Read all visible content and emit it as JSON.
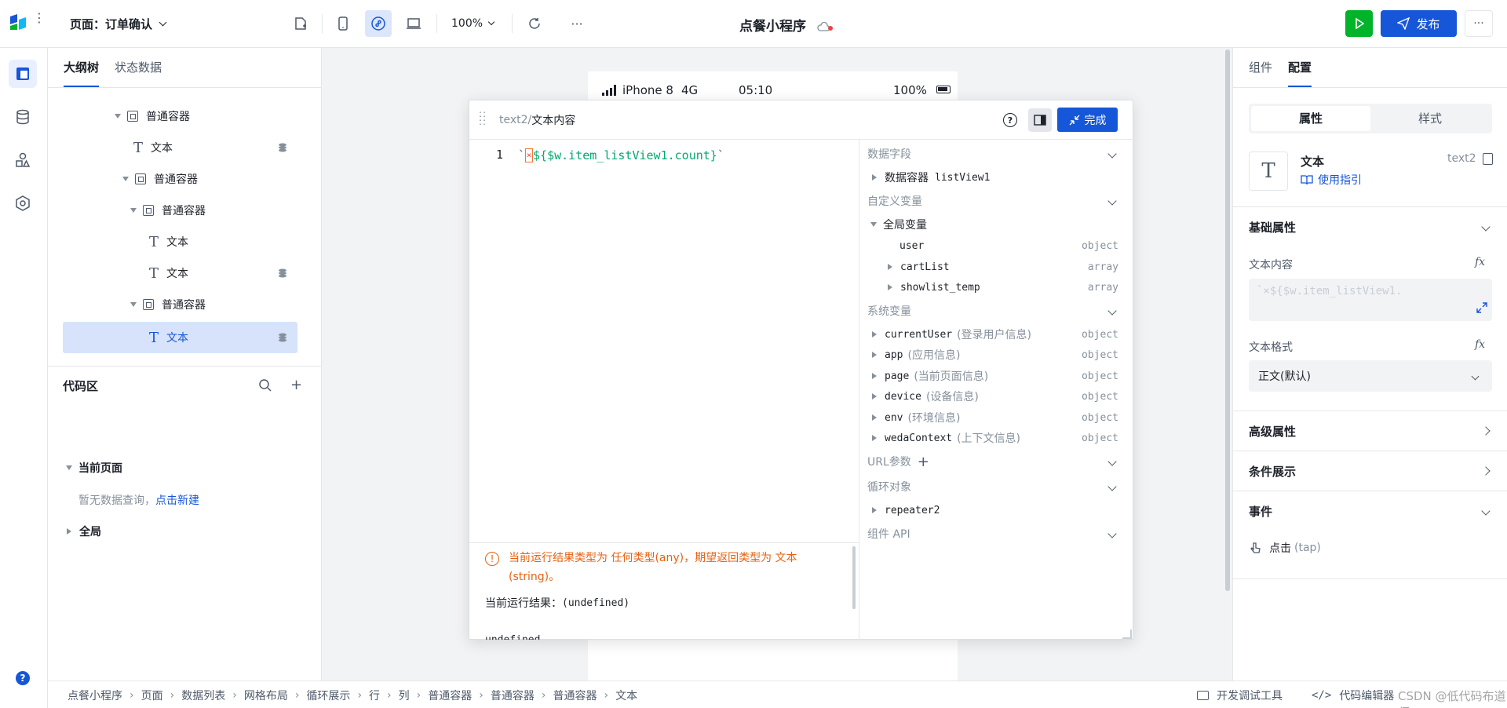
{
  "topbar": {
    "page_label": "页面：订单确认",
    "zoom": "100%",
    "app_title": "点餐小程序",
    "publish_label": "发布"
  },
  "outline": {
    "tabs": [
      "大纲树",
      "状态数据"
    ],
    "nodes": [
      "普通容器",
      "文本",
      "普通容器",
      "普通容器",
      "文本",
      "文本",
      "普通容器",
      "文本"
    ],
    "code_title": "代码区",
    "current_page": "当前页面",
    "empty_text": "暂无数据查询，",
    "create_link": "点击新建",
    "global": "全局"
  },
  "phone": {
    "carrier": "iPhone 8",
    "network": "4G",
    "time": "05:10",
    "battery": "100%"
  },
  "editor": {
    "crumb_prefix": "text2/",
    "crumb_title": "文本内容",
    "done_label": "完成",
    "line_no": "1",
    "code_backtick_open": "`",
    "code_expr": "${$w.item_listView1.count}",
    "code_backtick_close": "`",
    "warning": "当前运行结果类型为 任何类型(any)，期望返回类型为 文本(string)。",
    "result_label": "当前运行结果：",
    "result_value": "(undefined)",
    "result_cut": "undefined"
  },
  "vars": {
    "data_fields": "数据字段",
    "data_container": "数据容器",
    "data_container_code": "listView1",
    "custom_vars": "自定义变量",
    "global_vars": "全局变量",
    "globals": [
      {
        "name": "user",
        "type": "object"
      },
      {
        "name": "cartList",
        "type": "array"
      },
      {
        "name": "showlist_temp",
        "type": "array"
      }
    ],
    "system_vars": "系统变量",
    "systems": [
      {
        "name": "currentUser",
        "desc": "(登录用户信息)",
        "type": "object"
      },
      {
        "name": "app",
        "desc": "(应用信息)",
        "type": "object"
      },
      {
        "name": "page",
        "desc": "(当前页面信息)",
        "type": "object"
      },
      {
        "name": "device",
        "desc": "(设备信息)",
        "type": "object"
      },
      {
        "name": "env",
        "desc": "(环境信息)",
        "type": "object"
      },
      {
        "name": "wedaContext",
        "desc": "(上下文信息)",
        "type": "object"
      }
    ],
    "url_params": "URL参数",
    "loop_object": "循环对象",
    "repeater": "repeater2",
    "component_api": "组件 API"
  },
  "right": {
    "tabs": [
      "组件",
      "配置"
    ],
    "seg": [
      "属性",
      "样式"
    ],
    "comp_name": "文本",
    "comp_id": "text2",
    "guide": "使用指引",
    "basic": "基础属性",
    "text_content": "文本内容",
    "text_preview": "`×${$w.item_listView1.",
    "text_format": "文本格式",
    "format_value": "正文(默认)",
    "advanced": "高级属性",
    "conditional": "条件展示",
    "events": "事件",
    "event_click": "点击",
    "event_tap": "(tap)",
    "fx": "fx"
  },
  "footer": {
    "crumbs": [
      "点餐小程序",
      "页面",
      "数据列表",
      "网格布局",
      "循环展示",
      "行",
      "列",
      "普通容器",
      "普通容器",
      "普通容器",
      "文本"
    ],
    "dev_tools": "开发调试工具",
    "code_editor": "代码编辑器",
    "watermark": "CSDN @低代码布道师"
  },
  "colors": {
    "primary": "#1656d8",
    "run": "#00b42a",
    "warn": "#e8600f"
  }
}
